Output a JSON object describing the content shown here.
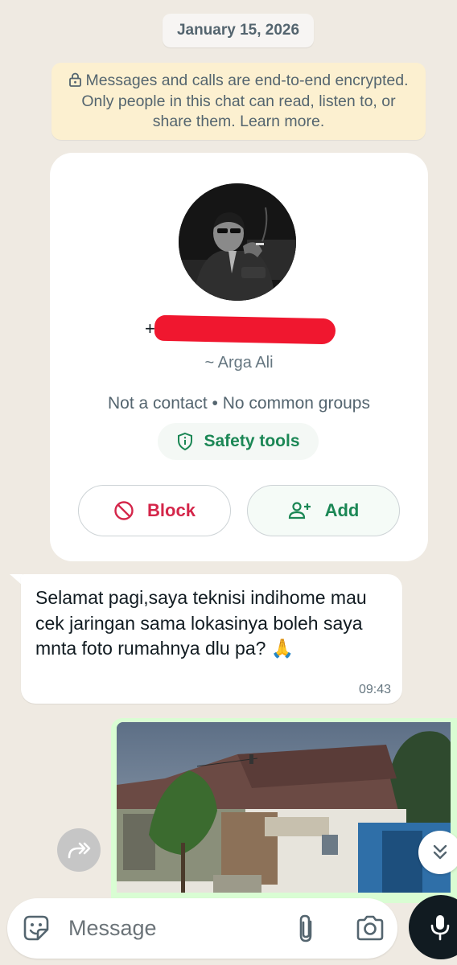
{
  "chat": {
    "date_chip": "January 15, 2026",
    "encryption_notice": "Messages and calls are end-to-end encrypted. Only people in this chat can read, listen to, or share them. Learn more."
  },
  "profile": {
    "phone_prefix": "+",
    "phone_number": "",
    "push_name": "~ Arga Ali",
    "contact_info": "Not a contact • No common groups",
    "safety_tools_label": "Safety tools",
    "block_label": "Block",
    "add_label": "Add"
  },
  "messages": [
    {
      "direction": "incoming",
      "text": "Selamat pagi,saya teknisi indihome mau cek jaringan sama lokasinya boleh saya mnta foto rumahnya dlu pa?",
      "emoji": "🙏",
      "time": "09:43"
    },
    {
      "direction": "outgoing",
      "type": "image"
    }
  ],
  "composer": {
    "placeholder": "Message"
  },
  "icons": {
    "encryption": "lock-icon",
    "safety": "shield-info-icon",
    "block": "block-icon",
    "add": "add-person-icon",
    "forward": "forward-icon",
    "scroll": "double-chevron-down-icon",
    "sticker": "sticker-icon",
    "attach": "paperclip-icon",
    "camera": "camera-icon",
    "mic": "mic-icon"
  },
  "colors": {
    "chat_background": "#efeae2",
    "incoming_bubble": "#ffffff",
    "outgoing_bubble": "#d9fdd3",
    "accent_green": "#1b8755",
    "block_red": "#d4264a",
    "notice_background": "#fcf0d0"
  }
}
